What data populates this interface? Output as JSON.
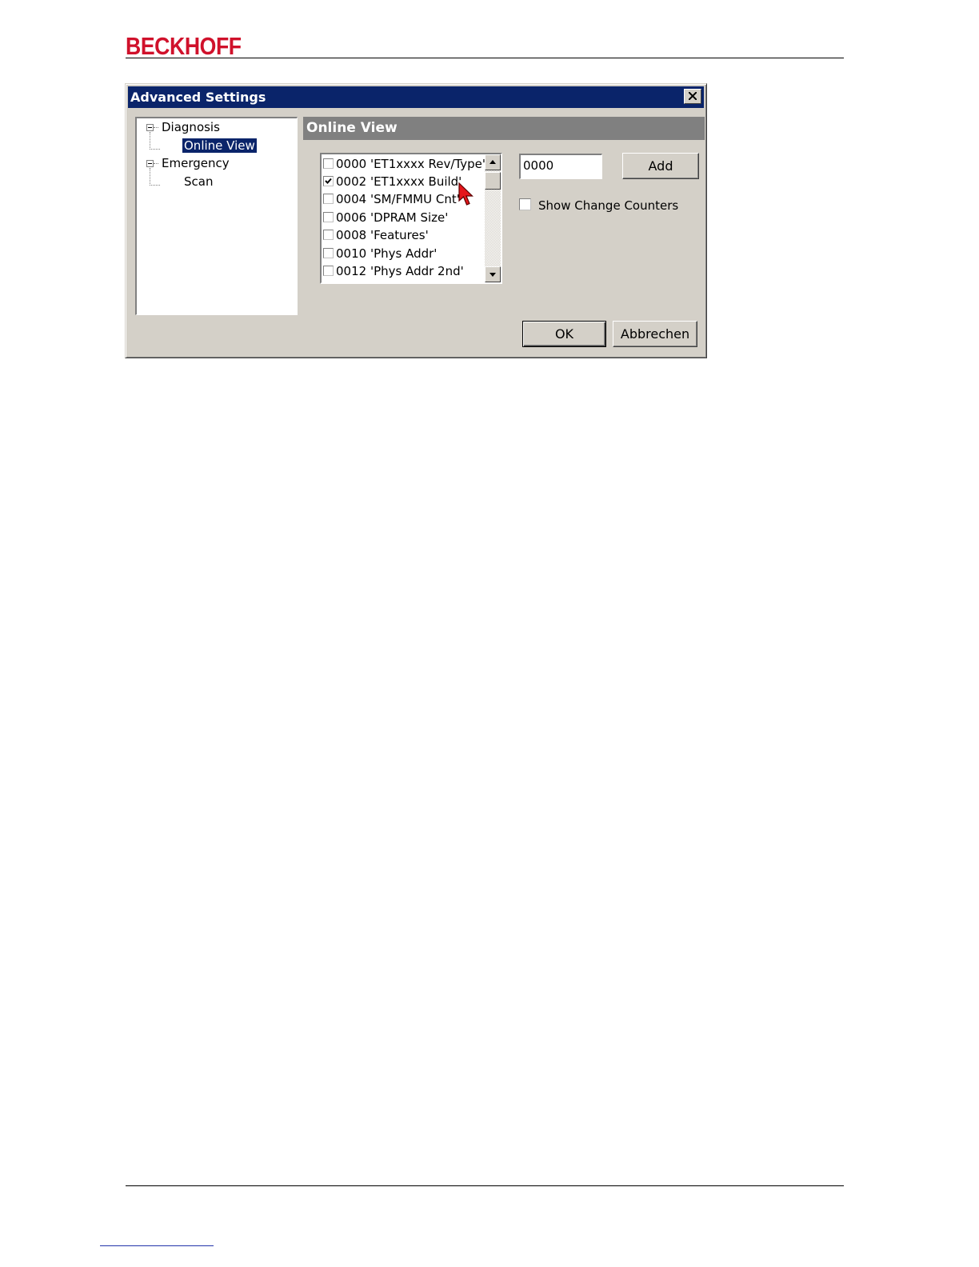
{
  "page": {
    "brand": "BECKHOFF",
    "brand_color": "#d0112b"
  },
  "dialog": {
    "title": "Advanced Settings",
    "close_icon": "close-icon",
    "tree": {
      "items": [
        {
          "label": "Diagnosis",
          "expanded": true,
          "children": [
            {
              "label": "Online View",
              "selected": true
            }
          ]
        },
        {
          "label": "Emergency",
          "expanded": true,
          "children": [
            {
              "label": "Scan",
              "selected": false
            }
          ]
        }
      ]
    },
    "section_title": "Online View",
    "list": {
      "items": [
        {
          "label": "0000 'ET1xxxx Rev/Type'",
          "checked": false
        },
        {
          "label": "0002 'ET1xxxx Build'",
          "checked": true
        },
        {
          "label": "0004 'SM/FMMU Cnt'",
          "checked": false
        },
        {
          "label": "0006 'DPRAM Size'",
          "checked": false
        },
        {
          "label": "0008 'Features'",
          "checked": false
        },
        {
          "label": "0010 'Phys Addr'",
          "checked": false
        },
        {
          "label": "0012 'Phys Addr 2nd'",
          "checked": false
        }
      ]
    },
    "address_input": "0000",
    "add_label": "Add",
    "show_change_counters_label": "Show Change Counters",
    "show_change_counters_checked": false,
    "ok_label": "OK",
    "cancel_label": "Abbrechen"
  }
}
